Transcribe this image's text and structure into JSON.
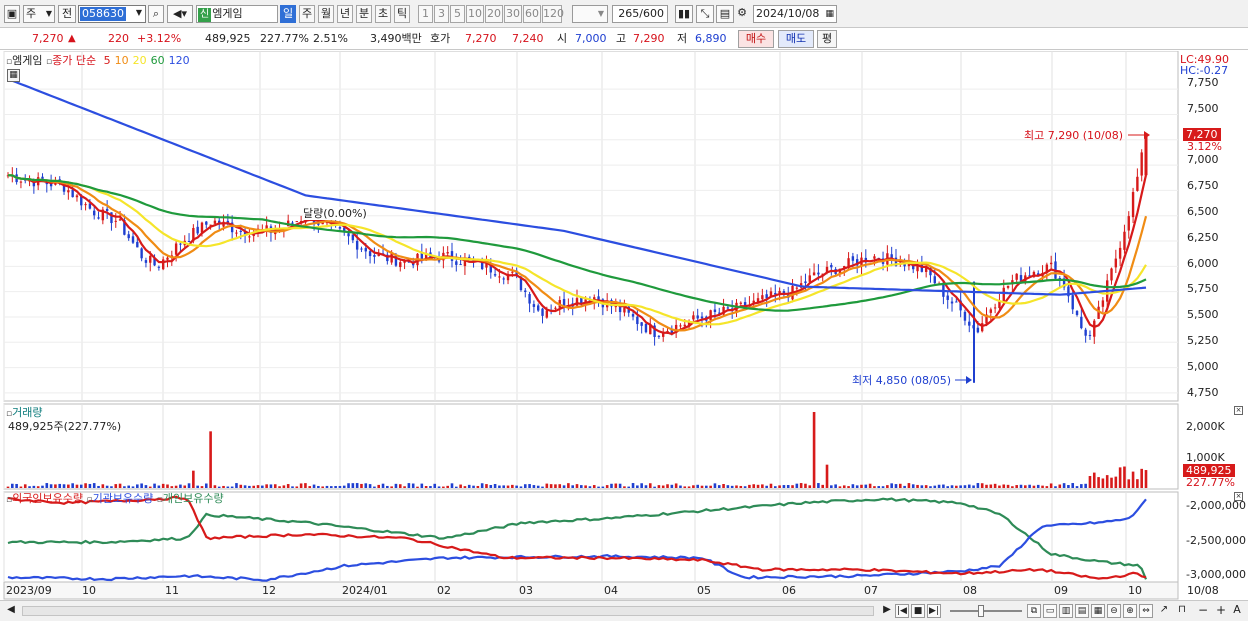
{
  "toolbar": {
    "sel1": "주",
    "sel2": "전",
    "code": "058630",
    "market_badge": "신",
    "stock_name": "엠게임",
    "periods": [
      "일",
      "주",
      "월",
      "년",
      "분",
      "초",
      "틱"
    ],
    "intervals": [
      "1",
      "3",
      "5",
      "10",
      "20",
      "30",
      "60",
      "120"
    ],
    "count": "265/600",
    "date": "2024/10/08"
  },
  "quote": {
    "price": "7,270",
    "change": "220",
    "rate": "+3.12%",
    "volume": "489,925",
    "vol_ratio": "227.77%",
    "turnover": "2.51%",
    "amount": "3,490백만",
    "hoga_label": "호가",
    "ask": "7,270",
    "bid": "7,240",
    "open_label": "시",
    "open": "7,000",
    "high_label": "고",
    "high": "7,290",
    "low_label": "저",
    "low": "6,890",
    "buy": "매수",
    "sell": "매도",
    "eval": "평"
  },
  "price_panel": {
    "title": "엠게임",
    "ma_label": "종가 단순",
    "ma_periods": [
      "5",
      "10",
      "20",
      "60",
      "120"
    ],
    "ma_colors": [
      "#d71a1a",
      "#f08c14",
      "#f5e52a",
      "#1f9a3c",
      "#2c4ee0"
    ],
    "lc": "LC:49.90",
    "hc": "HC:-0.27",
    "ticks": [
      "7,750",
      "7,500",
      "7,250",
      "7,000",
      "6,750",
      "6,500",
      "6,250",
      "6,000",
      "5,750",
      "5,500",
      "5,250",
      "5,000",
      "4,750"
    ],
    "last_price": "7,270",
    "last_rate": "3.12%",
    "max_label": "최고 7,290 (10/08)",
    "min_label": "최저 4,850 (08/05)",
    "note": "달량(0.00%)"
  },
  "volume_panel": {
    "title": "거래량",
    "value": "489,925주(227.77%)",
    "ticks": [
      "2,000K",
      "1,000K"
    ],
    "last": "489,925",
    "last_rate": "227.77%"
  },
  "holdings_panel": {
    "legend": [
      "외국인보유수량",
      "기관보유수량",
      "개인보유수량"
    ],
    "colors": [
      "#d71a1a",
      "#2c4ee0",
      "#2e8b57"
    ],
    "ticks": [
      "-2,000,000",
      "-2,500,000",
      "-3,000,000"
    ]
  },
  "x_axis": {
    "labels": [
      "2023/09",
      "10",
      "11",
      "12",
      "2024/01",
      "02",
      "03",
      "04",
      "05",
      "06",
      "07",
      "08",
      "09",
      "10",
      "10/08"
    ]
  },
  "colors": {
    "up": "#d71a1a",
    "down": "#1f3fd0",
    "grid": "#e2e2e2",
    "active": "#2f6fd6"
  },
  "chart_data": {
    "type": "line",
    "title": "엠게임",
    "series": [
      {
        "name": "종가",
        "x": [
          "2023/09",
          "2023/10",
          "2023/11",
          "2023/12",
          "2024/01",
          "2024/02",
          "2024/03",
          "2024/04",
          "2024/05",
          "2024/06",
          "2024/07",
          "2024/08",
          "2024/09",
          "2024/10/08"
        ],
        "values": [
          6900,
          6550,
          6200,
          6450,
          6100,
          6050,
          5600,
          5350,
          5650,
          5900,
          6050,
          5550,
          5900,
          7270
        ]
      },
      {
        "name": "120",
        "x": [
          "2023/09",
          "2023/12",
          "2024/03",
          "2024/06",
          "2024/09",
          "2024/10/08"
        ],
        "values": [
          7850,
          6700,
          6350,
          5800,
          5720,
          5790
        ]
      }
    ],
    "annotations": [
      {
        "label": "최고 7,290 (10/08)",
        "value": 7290
      },
      {
        "label": "최저 4,850 (08/05)",
        "value": 4850
      }
    ],
    "ylim": [
      4700,
      7850
    ]
  }
}
